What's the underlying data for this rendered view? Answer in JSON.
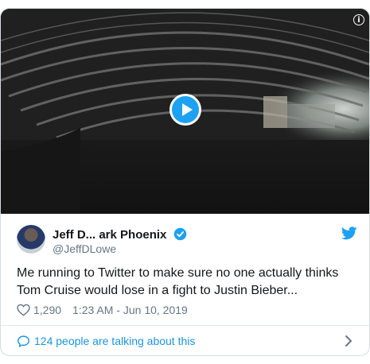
{
  "tweet": {
    "display_name": "Jeff D... ark Phoenix",
    "handle": "@JeffDLowe",
    "text": "Me running to Twitter to make sure no one actually thinks Tom Cruise would lose in a fight to Justin Bieber...",
    "likes": "1,290",
    "timestamp": "1:23 AM - Jun 10, 2019",
    "talking": "124 people are talking about this"
  },
  "media": {
    "info_glyph": "i"
  },
  "colors": {
    "brand": "#1da1f2",
    "link": "#1b95e0",
    "muted": "#657786",
    "text": "#14171a"
  },
  "icons": [
    "info-icon",
    "play-icon",
    "verified-badge-icon",
    "twitter-bird-icon",
    "heart-icon",
    "speech-bubble-icon",
    "chevron-right-icon"
  ]
}
